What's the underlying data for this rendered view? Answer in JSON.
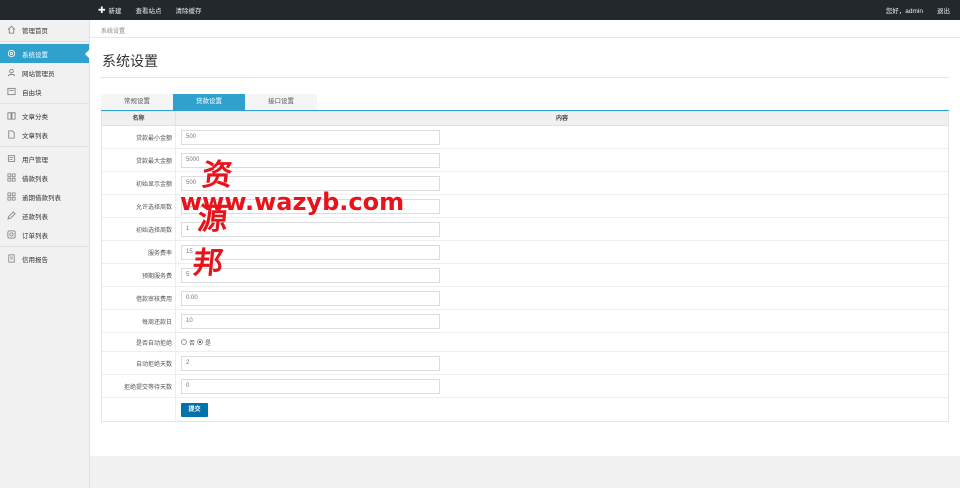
{
  "topbar": {
    "links": [
      {
        "label": "新建",
        "icon": "plus-icon"
      },
      {
        "label": "查看站点"
      },
      {
        "label": "清除缓存"
      }
    ],
    "greeting": "您好，admin",
    "logout": "退出"
  },
  "sidebar": {
    "items": [
      {
        "label": "管理首页",
        "icon": "home-icon"
      },
      {
        "label": "系统设置",
        "icon": "gear-icon",
        "active": true
      },
      {
        "label": "网站管理员",
        "icon": "user-icon"
      },
      {
        "label": "自由块",
        "icon": "block-icon"
      },
      {
        "label": "文章分类",
        "icon": "book-icon"
      },
      {
        "label": "文章列表",
        "icon": "document-icon"
      },
      {
        "label": "用户管理",
        "icon": "users-icon"
      },
      {
        "label": "借款列表",
        "icon": "grid-icon"
      },
      {
        "label": "逾期借款列表",
        "icon": "grid-icon"
      },
      {
        "label": "还款列表",
        "icon": "edit-icon"
      },
      {
        "label": "订单列表",
        "icon": "order-icon"
      },
      {
        "label": "信用报告",
        "icon": "report-icon"
      }
    ]
  },
  "main": {
    "breadcrumb": "系统设置",
    "title": "系统设置",
    "tabs": [
      {
        "label": "常规设置"
      },
      {
        "label": "贷款设置",
        "active": true
      },
      {
        "label": "接口设置"
      }
    ],
    "table": {
      "col_name": "名称",
      "col_content": "内容",
      "rows": [
        {
          "label": "贷款最小金额",
          "value": "500"
        },
        {
          "label": "贷款最大金额",
          "value": "5000"
        },
        {
          "label": "初始显示金额",
          "value": "500"
        },
        {
          "label": "允许选择周数",
          "value": "1,2,3,4"
        },
        {
          "label": "初始选择周数",
          "value": "1"
        },
        {
          "label": "服务费率",
          "value": "15"
        },
        {
          "label": "预期服务费",
          "value": "5"
        },
        {
          "label": "借款审核费用",
          "value": "0.00"
        },
        {
          "label": "每周还款日",
          "value": "10"
        },
        {
          "label": "是否自动拒绝",
          "radio": {
            "no": "否",
            "yes": "是",
            "selected": "是"
          }
        },
        {
          "label": "自动拒绝天数",
          "value": "2"
        },
        {
          "label": "拒绝提交等待天数",
          "value": "0"
        }
      ],
      "submit_label": "提交"
    }
  },
  "watermark": {
    "cn": "资源邦",
    "url": "www.wazyb.com"
  },
  "colors": {
    "topbar": "#23282d",
    "accent": "#2ea2cc",
    "button": "#0073aa",
    "watermark": "#e8141b"
  }
}
